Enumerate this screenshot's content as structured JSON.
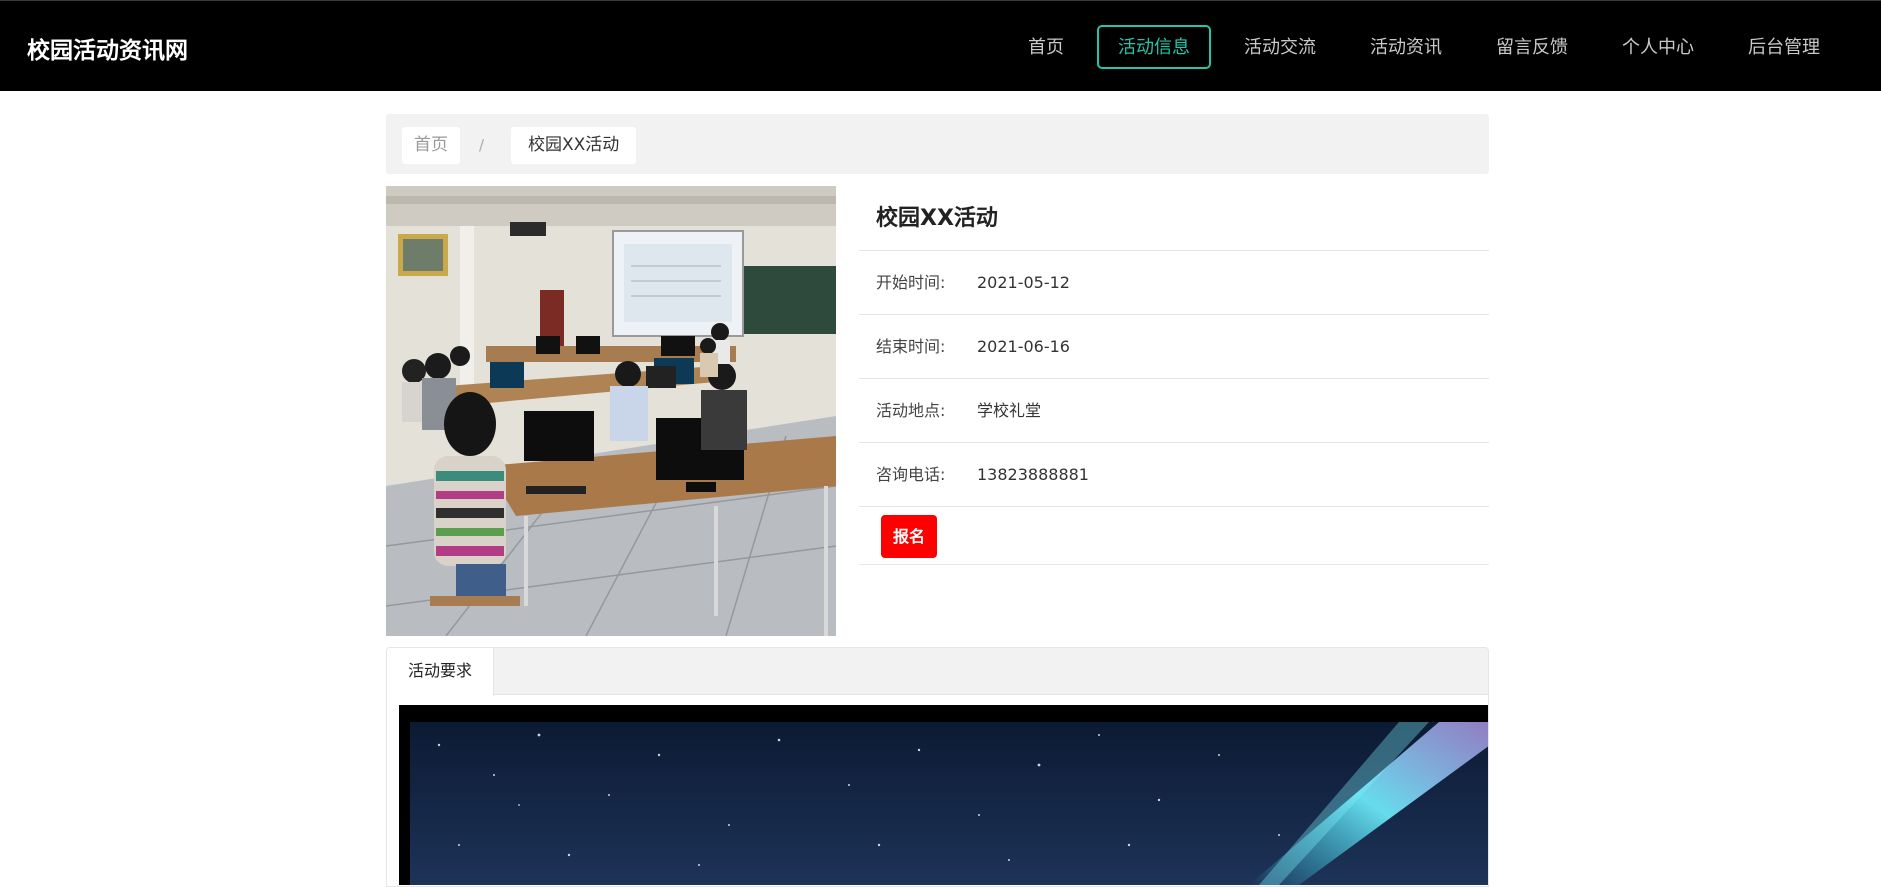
{
  "header": {
    "brand": "校园活动资讯网",
    "nav": [
      {
        "label": "首页",
        "active": false
      },
      {
        "label": "活动信息",
        "active": true
      },
      {
        "label": "活动交流",
        "active": false
      },
      {
        "label": "活动资讯",
        "active": false
      },
      {
        "label": "留言反馈",
        "active": false
      },
      {
        "label": "个人中心",
        "active": false
      },
      {
        "label": "后台管理",
        "active": false
      }
    ],
    "accent_color": "#23c6a6"
  },
  "breadcrumb": {
    "home": "首页",
    "separator": "/",
    "current": "校园XX活动"
  },
  "activity": {
    "title": "校园XX活动",
    "fields": [
      {
        "label": "开始时间:",
        "value": "2021-05-12"
      },
      {
        "label": "结束时间:",
        "value": "2021-06-16"
      },
      {
        "label": "活动地点:",
        "value": "学校礼堂"
      },
      {
        "label": "咨询电话:",
        "value": "13823888881"
      }
    ],
    "signup_label": "报名",
    "signup_color": "#ff0000"
  },
  "tabs": [
    {
      "label": "活动要求",
      "active": true
    }
  ]
}
